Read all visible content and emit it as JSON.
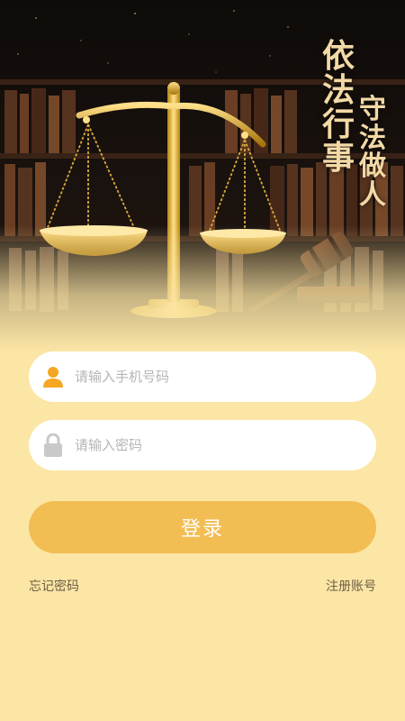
{
  "banner": {
    "slogan_line1": [
      "依",
      "法",
      "行",
      "事"
    ],
    "slogan_line2": [
      "守",
      "法",
      "做",
      "人"
    ],
    "image": "scales-of-justice-and-gavel-in-library"
  },
  "form": {
    "phone": {
      "placeholder": "请输入手机号码",
      "value": "",
      "icon": "user-icon"
    },
    "password": {
      "placeholder": "请输入密码",
      "value": "",
      "icon": "lock-icon"
    },
    "login_label": "登录"
  },
  "links": {
    "forgot_password": "忘记密码",
    "register": "注册账号"
  },
  "colors": {
    "page_background": "#fbe6a6",
    "button": "#f2bd52",
    "user_icon": "#f5a623",
    "lock_icon": "#c9c9c9",
    "link_text": "#6d5e43"
  }
}
